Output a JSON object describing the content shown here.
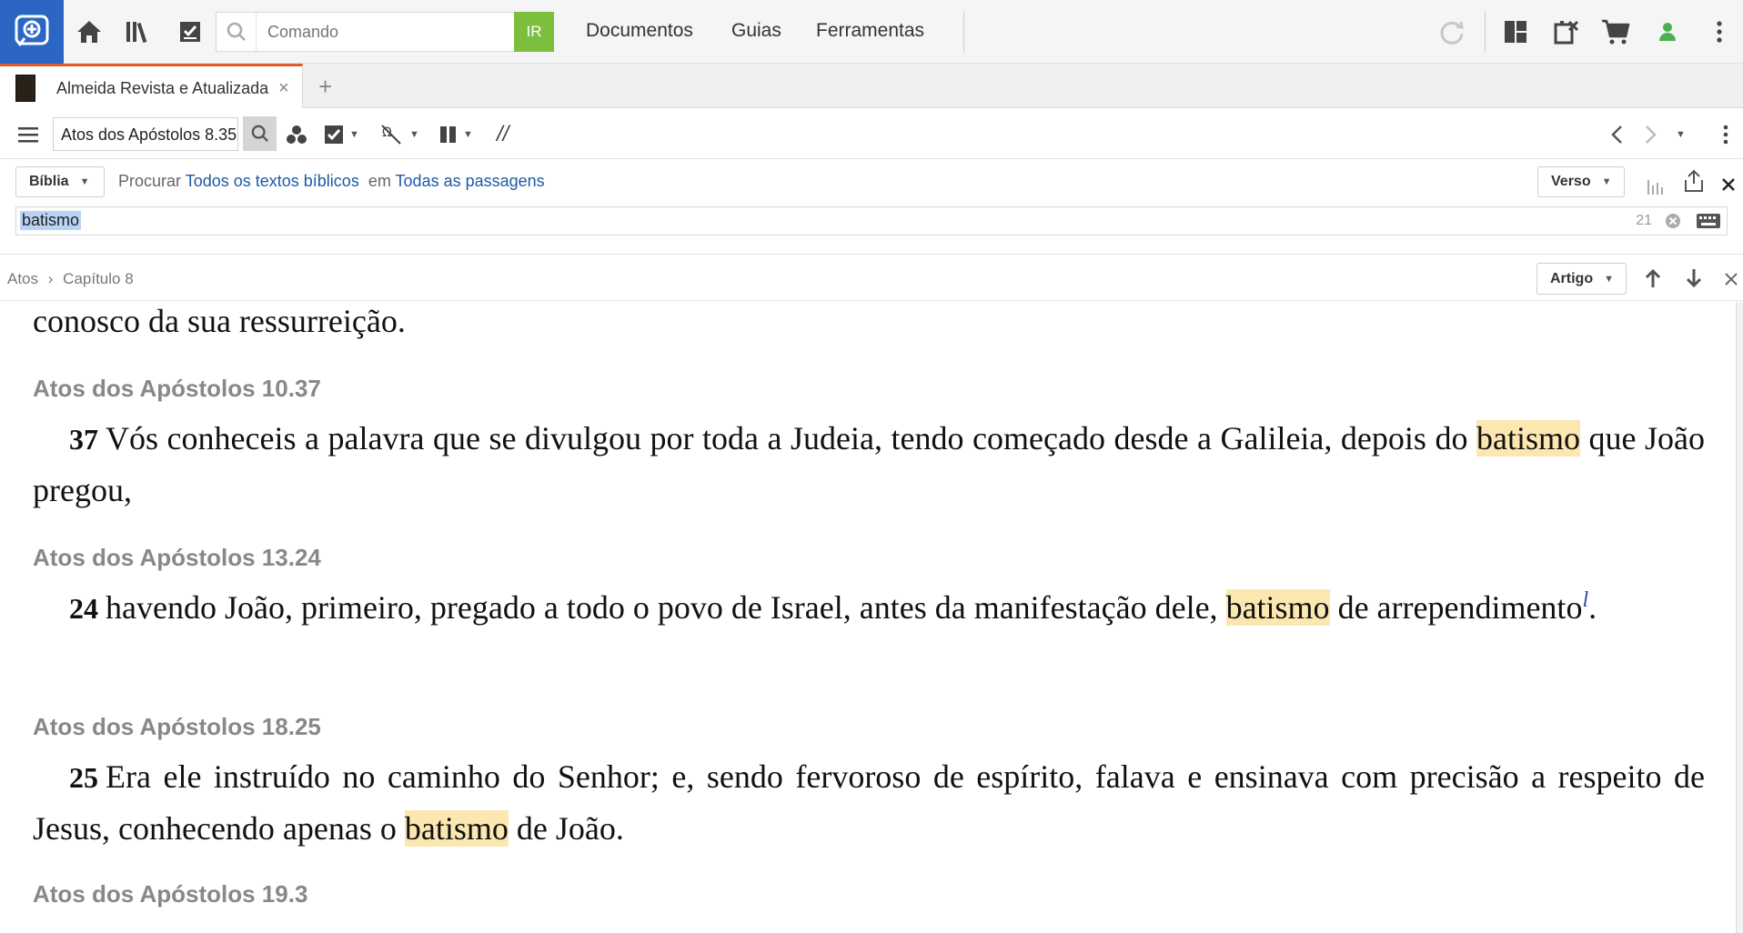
{
  "topbar": {
    "command_placeholder": "Comando",
    "go_label": "IR",
    "menu": [
      "Documentos",
      "Guias",
      "Ferramentas"
    ]
  },
  "tab": {
    "title": "Almeida Revista e Atualizada",
    "close": "×",
    "new_tab": "+"
  },
  "toolbar": {
    "reference": "Atos dos Apóstolos 8.35",
    "parallel": "//"
  },
  "search": {
    "scope": "Bíblia",
    "procurar": "Procurar",
    "texts_link": "Todos os textos bíblicos",
    "em": "em",
    "passages_link": "Todas as passagens",
    "view": "Verso",
    "query": "batismo",
    "count": "21"
  },
  "breadcrumb": {
    "book": "Atos",
    "sep": "›",
    "chapter": "Capítulo 8",
    "view": "Artigo"
  },
  "content": {
    "intro": "conosco da sua ressurreição.",
    "results": [
      {
        "ref": "Atos dos Apóstolos 10.37",
        "num": "37",
        "before": "Vós conheceis a palavra que se divulgou por toda a Judeia, tendo começado desde a Galileia, depois do ",
        "hit": "batismo",
        "after": " que João pregou,"
      },
      {
        "ref": "Atos dos Apóstolos 13.24",
        "num": "24",
        "before": "havendo João, primeiro, pregado a todo o povo de Israel, antes da manifestação dele, ",
        "hit": "batismo",
        "after": " de arrependimento",
        "footnote": "l",
        "end": "."
      },
      {
        "ref": "Atos dos Apóstolos 18.25",
        "num": "25",
        "before": "Era ele instruído no caminho do Senhor; e, sendo fervoroso de espírito, falava e ensinava com precisão a respeito de Jesus, conhecendo apenas o ",
        "hit": "batismo",
        "after": " de João."
      },
      {
        "ref": "Atos dos Apóstolos 19.3"
      }
    ]
  }
}
